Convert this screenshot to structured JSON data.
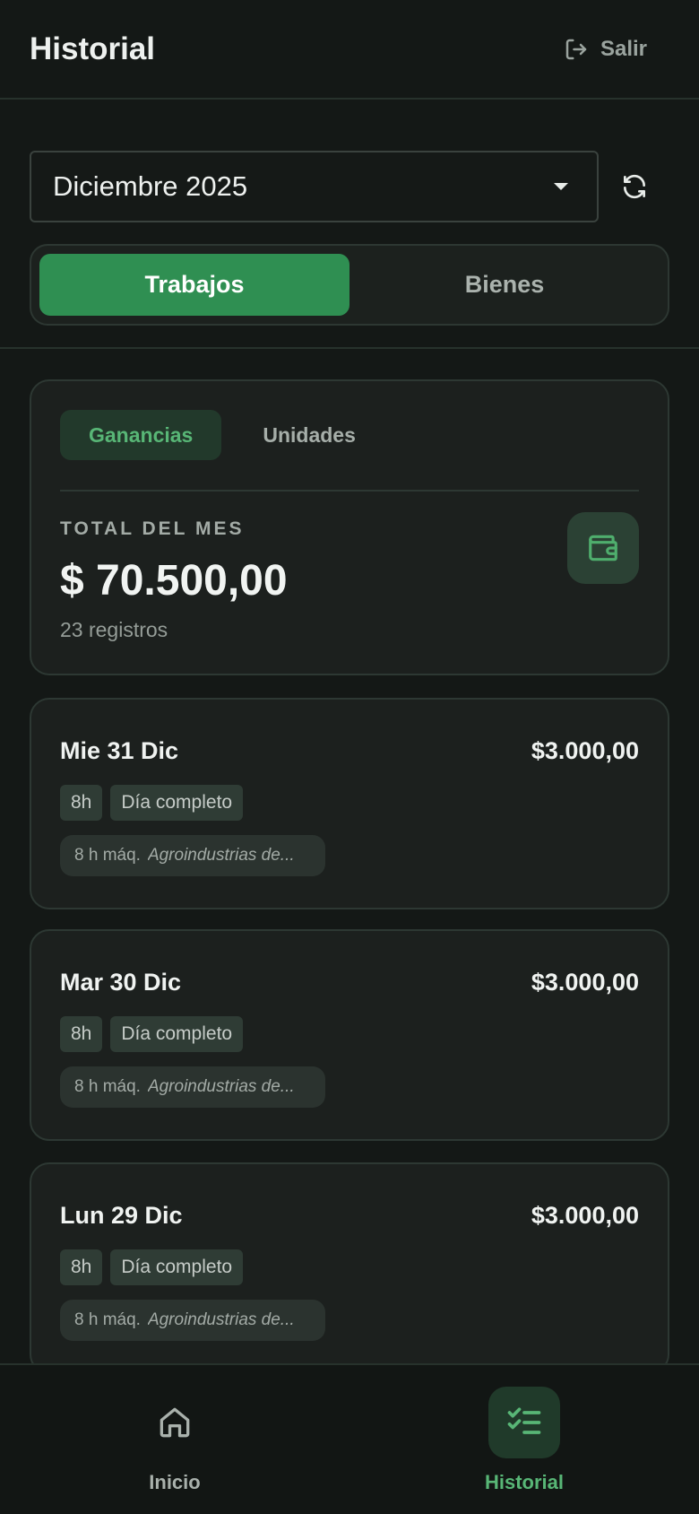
{
  "header": {
    "title": "Historial",
    "logout_label": "Salir",
    "logout_icon": "logout-icon"
  },
  "month_selector": {
    "value": "Diciembre 2025",
    "refresh_icon": "refresh-icon"
  },
  "segments": [
    {
      "label": "Trabajos",
      "active": true
    },
    {
      "label": "Bienes",
      "active": false
    }
  ],
  "summary": {
    "tabs": [
      {
        "label": "Ganancias",
        "active": true
      },
      {
        "label": "Unidades",
        "active": false
      }
    ],
    "total_label": "TOTAL DEL MES",
    "total_amount": "$ 70.500,00",
    "record_count": "23 registros",
    "icon": "wallet-icon"
  },
  "entries": [
    {
      "date": "Mie 31 Dic",
      "amount": "$3.000,00",
      "hours": "8h",
      "type": "Día completo",
      "machine_hours": "8 h máq.",
      "machine_name": "Agroindustrias de..."
    },
    {
      "date": "Mar 30 Dic",
      "amount": "$3.000,00",
      "hours": "8h",
      "type": "Día completo",
      "machine_hours": "8 h máq.",
      "machine_name": "Agroindustrias de..."
    },
    {
      "date": "Lun 29 Dic",
      "amount": "$3.000,00",
      "hours": "8h",
      "type": "Día completo",
      "machine_hours": "8 h máq.",
      "machine_name": "Agroindustrias de..."
    }
  ],
  "bottom_nav": [
    {
      "label": "Inicio",
      "icon": "home-icon",
      "active": false
    },
    {
      "label": "Historial",
      "icon": "checklist-icon",
      "active": true
    }
  ],
  "colors": {
    "background": "#141816",
    "accent": "#2f8f52",
    "accent_text": "#58b676",
    "card": "#1c201e"
  }
}
